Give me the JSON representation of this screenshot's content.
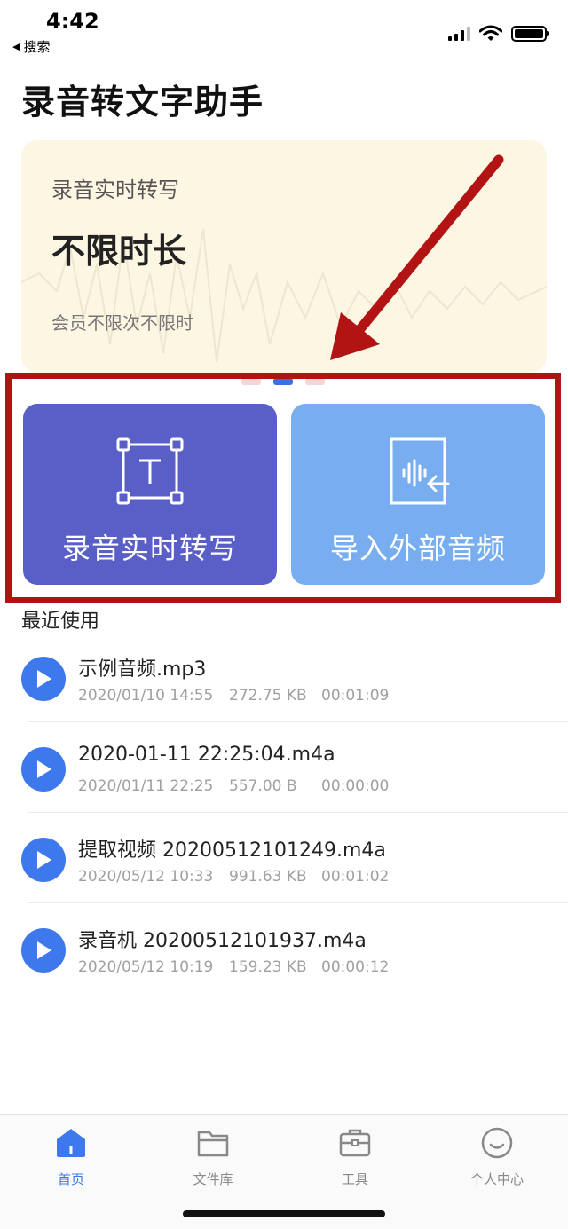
{
  "status_bar": {
    "time": "4:42",
    "back_label": "搜索"
  },
  "app_title": "录音转文字助手",
  "banner": {
    "kicker": "录音实时转写",
    "headline": "不限时长",
    "subtitle": "会员不限次不限时"
  },
  "actions": [
    {
      "label": "录音实时转写",
      "icon": "transcribe-text-icon",
      "color": "#5a5fc8"
    },
    {
      "label": "导入外部音频",
      "icon": "import-audio-icon",
      "color": "#78aef0"
    }
  ],
  "recent": {
    "title": "最近使用",
    "items": [
      {
        "name": "示例音频.mp3",
        "date": "2020/01/10 14:55",
        "size": "272.75 KB",
        "duration": "00:01:09"
      },
      {
        "name": "2020-01-11 22:25:04.m4a",
        "date": "2020/01/11 22:25",
        "size": "557.00 B",
        "duration": "00:00:00"
      },
      {
        "name": "提取视频 20200512101249.m4a",
        "date": "2020/05/12 10:33",
        "size": "991.63 KB",
        "duration": "00:01:02"
      },
      {
        "name": "录音机 20200512101937.m4a",
        "date": "2020/05/12 10:19",
        "size": "159.23 KB",
        "duration": "00:00:12"
      }
    ]
  },
  "tabs": [
    {
      "label": "首页",
      "icon": "home-icon",
      "active": true
    },
    {
      "label": "文件库",
      "icon": "folder-icon",
      "active": false
    },
    {
      "label": "工具",
      "icon": "toolbox-icon",
      "active": false
    },
    {
      "label": "个人中心",
      "icon": "smiley-profile-icon",
      "active": false
    }
  ],
  "colors": {
    "accent": "#3d79ec",
    "highlight_frame": "#b21414",
    "banner_bg": "#fdf6e3"
  }
}
